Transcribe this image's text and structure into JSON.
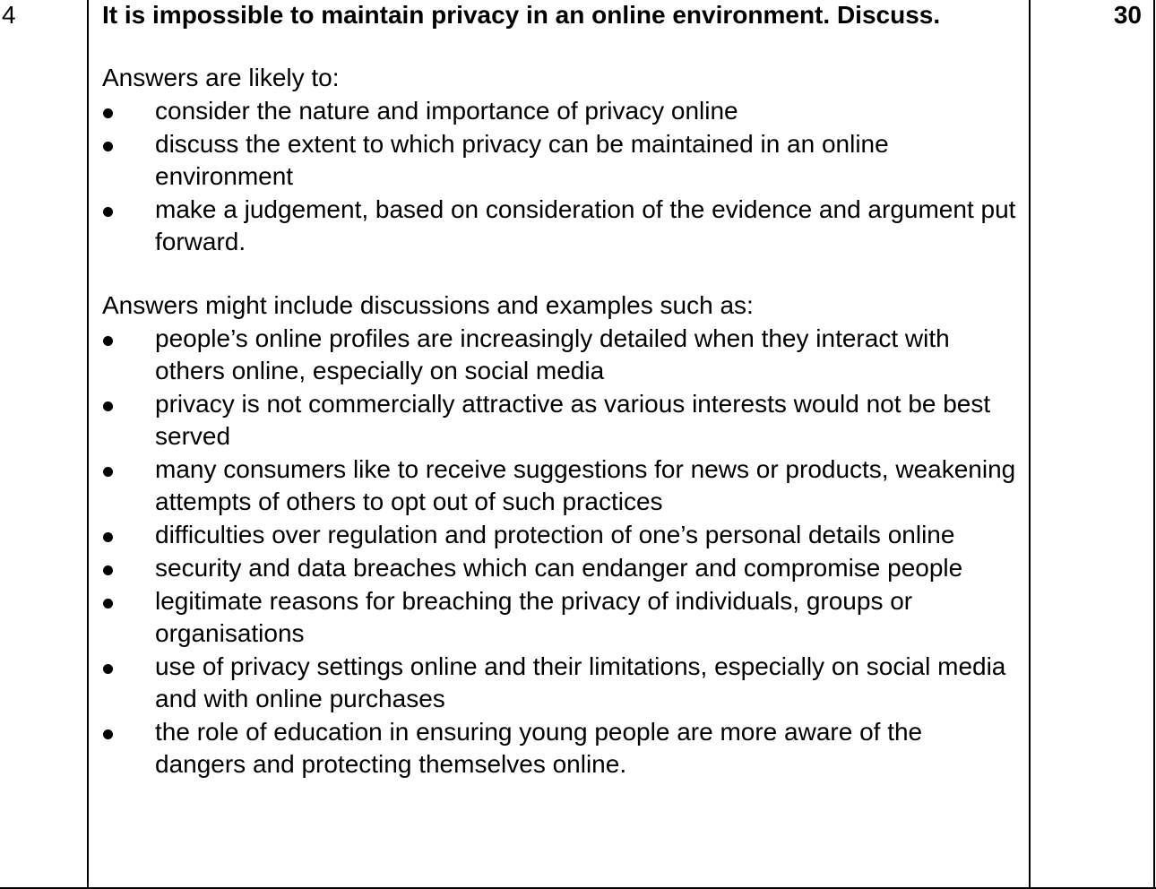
{
  "question_number": "4",
  "question": "It is impossible to maintain privacy in an online environment. Discuss.",
  "marks": "30",
  "likely_intro": "Answers are likely to:",
  "likely_points": [
    "consider the nature and importance of privacy online",
    "discuss the extent to which privacy can be maintained in an online environment",
    "make a judgement, based on consideration of the evidence and argument put forward."
  ],
  "include_intro": "Answers might include discussions and examples such as:",
  "include_points": [
    "people’s online profiles are increasingly detailed when they interact with others online, especially on social media",
    "privacy is not commercially attractive as various interests would not be best served",
    "many consumers like to receive suggestions for news or products, weakening attempts of others to opt out of such practices",
    "difficulties over regulation and protection of one’s personal details online",
    "security and data breaches which can endanger and compromise people",
    "legitimate reasons for breaching the privacy of individuals, groups or organisations",
    "use of privacy settings online and their limitations, especially on social media and with online purchases",
    "the role of education in ensuring young people are more aware of the dangers and protecting themselves online."
  ]
}
